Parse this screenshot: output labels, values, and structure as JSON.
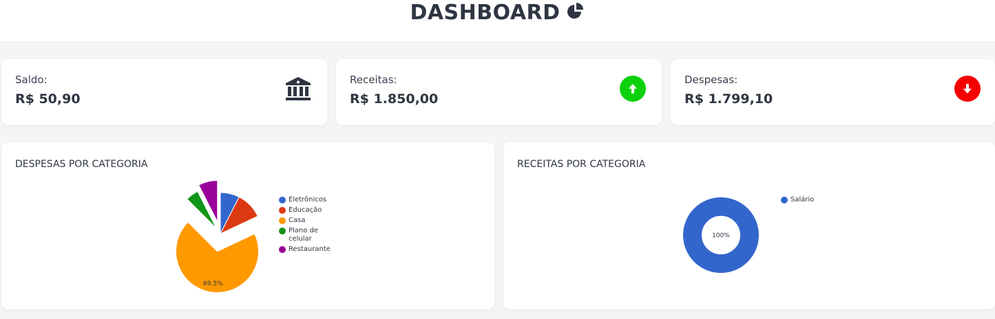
{
  "header": {
    "title": "DASHBOARD",
    "icon": "pie-chart-icon"
  },
  "stats": {
    "saldo": {
      "label": "Saldo:",
      "value": "R$ 50,90",
      "icon": "bank-icon",
      "icon_color": "#2f3542"
    },
    "receitas": {
      "label": "Receitas:",
      "value": "R$ 1.850,00",
      "icon": "arrow-up-icon",
      "icon_color": "#0cd10c"
    },
    "despesas": {
      "label": "Despesas:",
      "value": "R$ 1.799,10",
      "icon": "arrow-down-icon",
      "icon_color": "#f50000"
    }
  },
  "panels": {
    "despesas": {
      "title": "DESPESAS POR CATEGORIA"
    },
    "receitas": {
      "title": "RECEITAS POR CATEGORIA"
    }
  },
  "chart_data": [
    {
      "type": "pie",
      "title": "DESPESAS POR CATEGORIA",
      "categories": [
        "Eletrônicos",
        "Educação",
        "Casa",
        "Plano de celular",
        "Restaurante"
      ],
      "values": [
        7.5,
        10.5,
        69.5,
        5.0,
        7.5
      ],
      "colors": [
        "#3366cc",
        "#dc3912",
        "#ff9900",
        "#109618",
        "#990099"
      ],
      "slice_labels": [
        "",
        "",
        "69.5%",
        "",
        ""
      ],
      "exploded": true,
      "legend": "right"
    },
    {
      "type": "pie",
      "title": "RECEITAS POR CATEGORIA",
      "categories": [
        "Salário"
      ],
      "values": [
        100
      ],
      "colors": [
        "#3366cc"
      ],
      "slice_labels": [
        "100%"
      ],
      "donut": true,
      "legend": "right"
    }
  ]
}
